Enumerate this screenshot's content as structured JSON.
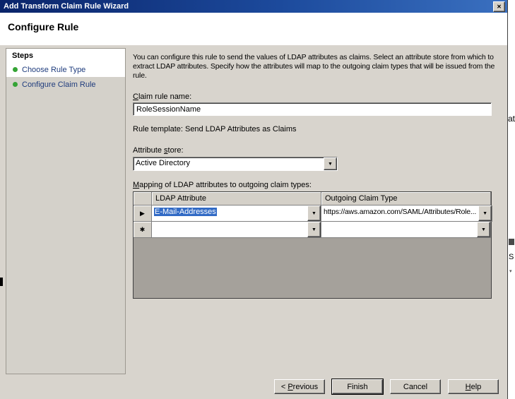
{
  "window": {
    "title": "Add Transform Claim Rule Wizard",
    "close_glyph": "✕"
  },
  "page": {
    "heading": "Configure Rule"
  },
  "steps": {
    "header": "Steps",
    "items": [
      {
        "label": "Choose Rule Type"
      },
      {
        "label": "Configure Claim Rule"
      }
    ]
  },
  "content": {
    "description": "You can configure this rule to send the values of LDAP attributes as claims. Select an attribute store from which to extract LDAP attributes. Specify how the attributes will map to the outgoing claim types that will be issued from the rule.",
    "claim_rule_name_label": {
      "key": "C",
      "rest": "laim rule name:"
    },
    "claim_rule_name_value": "RoleSessionName",
    "rule_template": "Rule template: Send LDAP Attributes as Claims",
    "attribute_store_label": {
      "pre": "Attribute ",
      "key": "s",
      "rest": "tore:"
    },
    "attribute_store_value": "Active Directory",
    "mapping_label": {
      "key": "M",
      "rest": "apping of LDAP attributes to outgoing claim types:"
    },
    "grid": {
      "columns": {
        "ldap": "LDAP Attribute",
        "claim": "Outgoing Claim Type"
      },
      "rows": [
        {
          "selector": "▶",
          "ldap": "E-Mail-Addresses",
          "claim": "https://aws.amazon.com/SAML/Attributes/Role..."
        },
        {
          "selector": "✱",
          "ldap": "",
          "claim": ""
        }
      ]
    }
  },
  "buttons": {
    "previous": {
      "pre": "< ",
      "key": "P",
      "rest": "revious"
    },
    "finish": "Finish",
    "cancel": "Cancel",
    "help": {
      "key": "H",
      "rest": "elp"
    }
  },
  "combo_arrow_glyph": "▼",
  "background": {
    "fragment_top": "at",
    "fragment_mid": "S",
    "fragment_caret": "▾"
  },
  "colors": {
    "titlebar_start": "#0a246a",
    "titlebar_end": "#3a70c0",
    "selection_highlight": "#316ac5",
    "step_bullet": "#35a435",
    "dialog_bg": "#d8d4cd",
    "grid_empty_bg": "#a5a19b"
  }
}
